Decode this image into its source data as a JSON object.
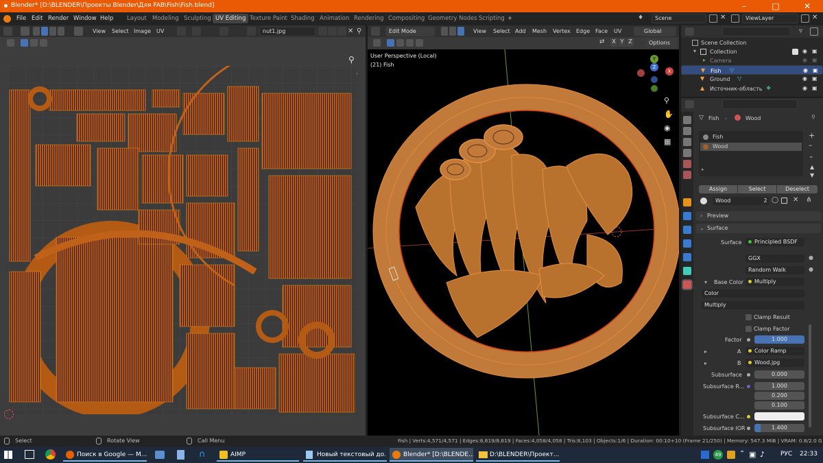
{
  "window": {
    "title": "Blender* [D:\\BLENDER\\Проекты Blender\\Для FAB\\Fish\\Fish.blend]"
  },
  "menu": {
    "items": [
      "File",
      "Edit",
      "Render",
      "Window",
      "Help"
    ]
  },
  "workspaces": [
    "Layout",
    "Modeling",
    "Sculpting",
    "UV Editing",
    "Texture Paint",
    "Shading",
    "Animation",
    "Rendering",
    "Compositing",
    "Geometry Nodes",
    "Scripting"
  ],
  "active_workspace": "UV Editing",
  "scene": {
    "label": "Scene"
  },
  "viewlayer": {
    "label": "ViewLayer"
  },
  "uv_editor": {
    "menus": [
      "View",
      "Select",
      "Image",
      "UV"
    ],
    "image_name": "nut1.jpg"
  },
  "viewport": {
    "mode": "Edit Mode",
    "menus": [
      "View",
      "Select",
      "Add",
      "Mesh",
      "Vertex",
      "Edge",
      "Face",
      "UV"
    ],
    "transform": "Global",
    "axes": [
      "X",
      "Y",
      "Z"
    ],
    "options_label": "Options",
    "overlay_title": "User Perspective (Local)",
    "overlay_object": "(21) Fish",
    "gizmo": [
      "X",
      "Y",
      "Z"
    ]
  },
  "outliner": {
    "root": "Scene Collection",
    "collection": "Collection",
    "items": [
      "Camera",
      "Fish",
      "Ground",
      "Источник-область"
    ]
  },
  "properties": {
    "breadcrumb": {
      "object": "Fish",
      "material": "Wood"
    },
    "slots": [
      "Fish",
      "Wood"
    ],
    "slot_buttons": [
      "Assign",
      "Select",
      "Deselect"
    ],
    "material_name": "Wood",
    "material_users": "2",
    "panels": {
      "preview": "Preview",
      "surface": "Surface"
    },
    "rows": {
      "surface_label": "Surface",
      "surface_value": "Principled BSDF",
      "distribution": "GGX",
      "subsurface_method": "Random Walk",
      "base_color_label": "Base Color",
      "base_color_value": "Multiply",
      "color_mode": "Color",
      "blend": "Multiply",
      "clamp_result": "Clamp Result",
      "clamp_factor": "Clamp Factor",
      "factor_label": "Factor",
      "factor_value": "1.000",
      "a_label": "A",
      "a_value": "Color Ramp",
      "b_label": "B",
      "b_value": "Wood.jpg",
      "subsurface_label": "Subsurface",
      "subsurface_value": "0.000",
      "subsurface_r_label": "Subsurface R...",
      "subsurface_r": [
        "1.000",
        "0.200",
        "0.100"
      ],
      "subsurface_c_label": "Subsurface C...",
      "subsurface_ior_label": "Subsurface IOR",
      "subsurface_ior_value": "1.400"
    }
  },
  "status": {
    "left": [
      "Select",
      "Rotate View",
      "Call Menu"
    ],
    "stats": "Fish | Verts:4,571/4,571 | Edges:8,619/8,619 | Faces:4,058/4,058 | Tris:8,103 | Objects:1/6 | Duration: 00:10+10 (Frame 21/250) | Memory: 547.3 MiB | VRAM: 0.8/2.0 GiB | 3.6.1"
  },
  "taskbar": {
    "apps": [
      "Поиск в Google — M...",
      "AIMP",
      "Новый текстовый до...",
      "Blender* [D:\\BLENDE...",
      "D:\\BLENDER\\Проект..."
    ],
    "badge": "49",
    "lang": "РУС",
    "time": "22:33"
  },
  "colors": {
    "accent": "#ea5a05",
    "uv_orange": "#c96a1f",
    "wire": "#d47a2a",
    "select_blue": "#4772b3"
  }
}
